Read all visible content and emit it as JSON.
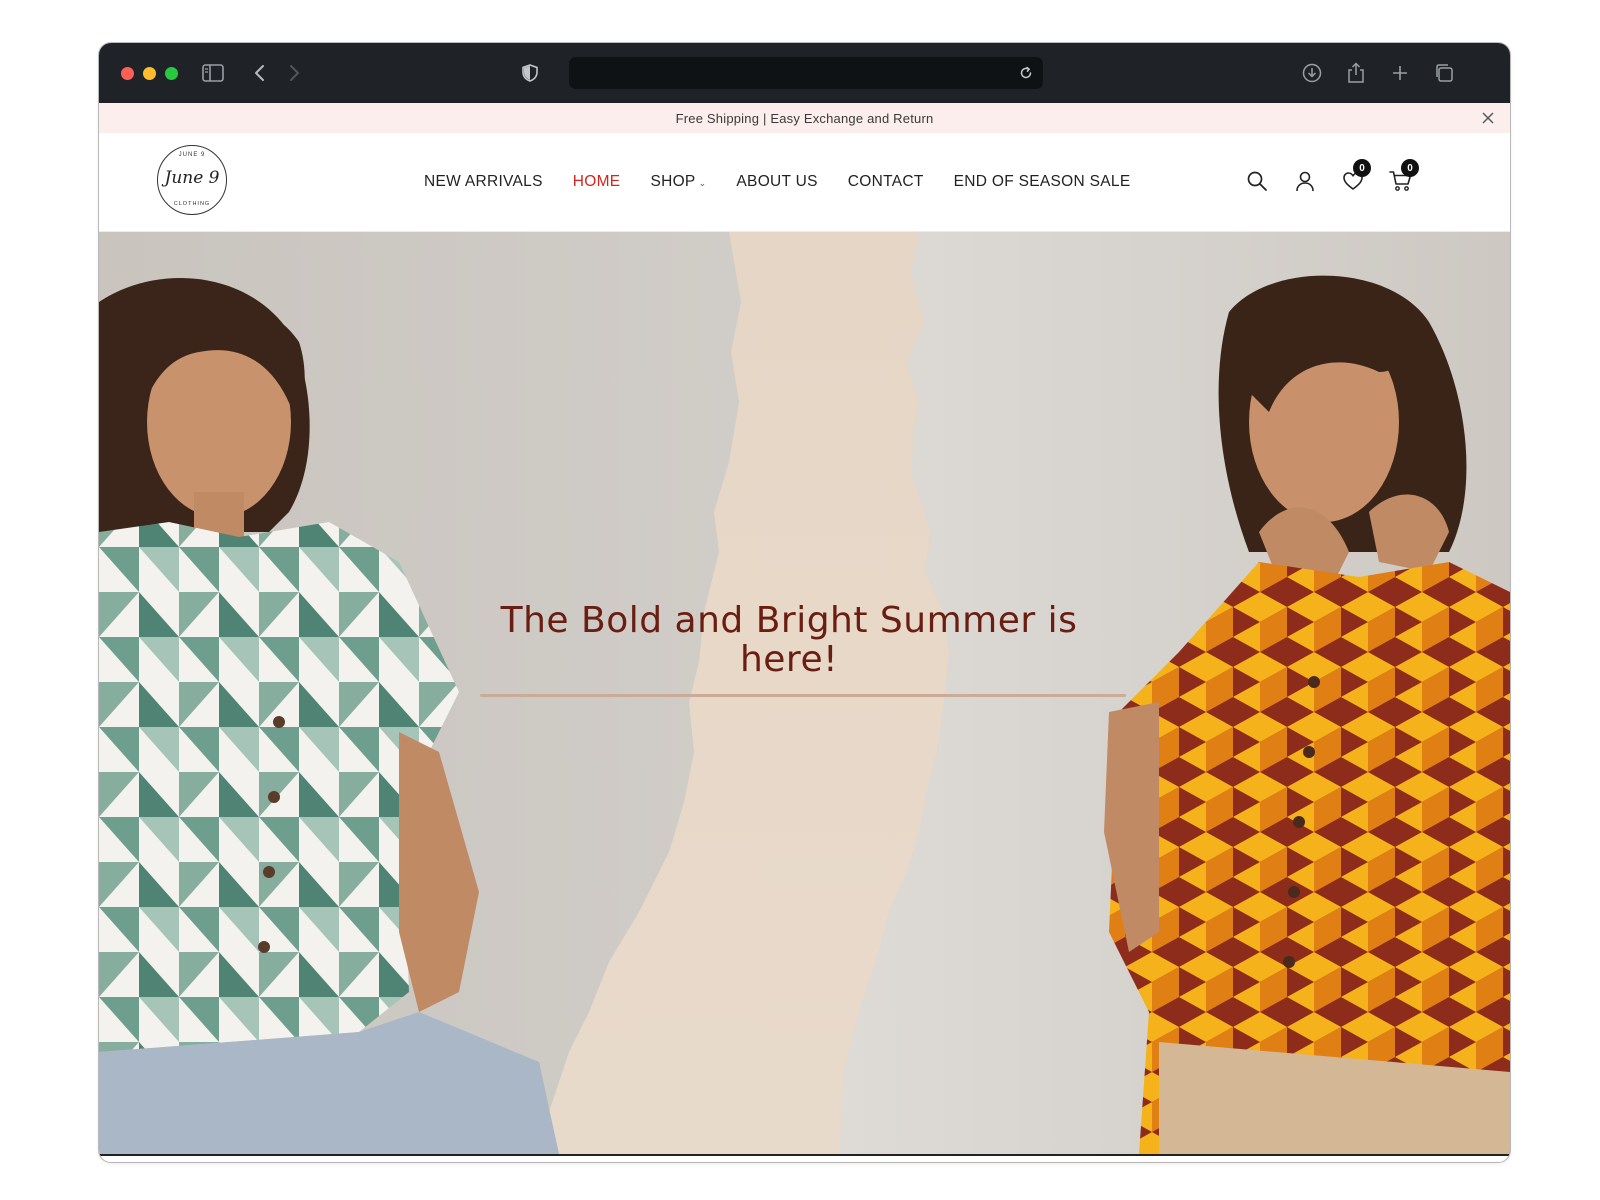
{
  "browser": {
    "url_text": ""
  },
  "announcement": {
    "text": "Free Shipping | Easy Exchange and Return"
  },
  "logo": {
    "top_text": "JUNE 9",
    "main_text": "June 9",
    "bottom_text": "CLOTHING"
  },
  "nav": {
    "items": [
      {
        "label": "NEW ARRIVALS"
      },
      {
        "label": "HOME"
      },
      {
        "label": "SHOP"
      },
      {
        "label": "ABOUT US"
      },
      {
        "label": "CONTACT"
      },
      {
        "label": "END OF SEASON SALE"
      }
    ],
    "active": "HOME"
  },
  "header_icons": {
    "wishlist_count": "0",
    "cart_count": "0"
  },
  "hero": {
    "title": "The Bold and Bright Summer is here!"
  },
  "colors": {
    "accent": "#d4231c",
    "announcement_bg": "#fdeeee",
    "hero_title": "#6a1e12",
    "hero_center": "#e7d8c8"
  }
}
